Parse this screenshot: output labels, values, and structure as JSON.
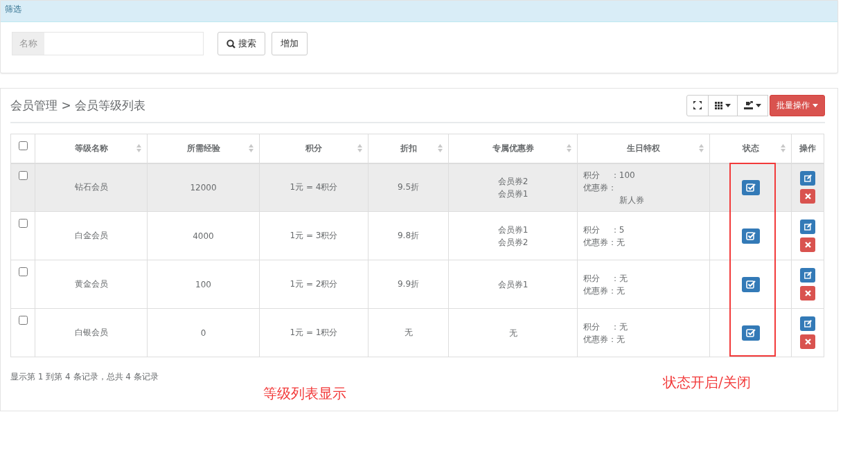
{
  "filter_panel": {
    "title": "筛选",
    "name_field": {
      "label": "名称"
    },
    "buttons": [
      {
        "kind": "search",
        "label": "搜索"
      },
      {
        "kind": "plain",
        "label": "增加"
      }
    ]
  },
  "list_panel": {
    "breadcrumb": "会员管理 > 会员等级列表",
    "toolbar": [
      {
        "kind": "fullscreen",
        "caret": false
      },
      {
        "kind": "columns",
        "caret": true
      },
      {
        "kind": "export",
        "caret": true
      },
      {
        "kind": "batch",
        "label": "批量操作",
        "caret": true
      }
    ],
    "table": {
      "select_all": {
        "checked": false
      },
      "columns": [
        {
          "label": "等级名称",
          "sortable": true
        },
        {
          "label": "所需经验",
          "sortable": true
        },
        {
          "label": "积分",
          "sortable": true
        },
        {
          "label": "折扣",
          "sortable": true
        },
        {
          "label": "专属优惠券",
          "sortable": true
        },
        {
          "label": "生日特权",
          "sortable": true
        },
        {
          "label": "状态",
          "sortable": true
        },
        {
          "label": "操作",
          "sortable": false
        }
      ],
      "rows": [
        {
          "checked": false,
          "highlighted": true,
          "name": "钻石会员",
          "experience": "12000",
          "points": "1元 = 4积分",
          "discount": "9.5折",
          "coupons": [
            "会员券2",
            "会员券1"
          ],
          "birthday": [
            {
              "text": "积分　 ：100",
              "indent": false
            },
            {
              "text": "优惠券：",
              "indent": false
            },
            {
              "text": "新人券",
              "indent": true
            }
          ],
          "enabled": true
        },
        {
          "checked": false,
          "highlighted": false,
          "name": "白金会员",
          "experience": "4000",
          "points": "1元 = 3积分",
          "discount": "9.8折",
          "coupons": [
            "会员券1",
            "会员券2"
          ],
          "birthday": [
            {
              "text": "积分　 ：5",
              "indent": false
            },
            {
              "text": "优惠券：无",
              "indent": false
            }
          ],
          "enabled": true
        },
        {
          "checked": false,
          "highlighted": false,
          "name": "黄金会员",
          "experience": "100",
          "points": "1元 = 2积分",
          "discount": "9.9折",
          "coupons": [
            "会员券1"
          ],
          "birthday": [
            {
              "text": "积分　 ：无",
              "indent": false
            },
            {
              "text": "优惠券：无",
              "indent": false
            }
          ],
          "enabled": true
        },
        {
          "checked": false,
          "highlighted": false,
          "name": "白银会员",
          "experience": "0",
          "points": "1元 = 1积分",
          "discount": "无",
          "coupons": [
            "无"
          ],
          "birthday": [
            {
              "text": "积分　 ：无",
              "indent": false
            },
            {
              "text": "优惠券：无",
              "indent": false
            }
          ],
          "enabled": true
        }
      ]
    },
    "pagination_info": "显示第 1 到第 4 条记录，总共 4 条记录"
  },
  "annotations": [
    {
      "kind": "text",
      "text": "等级列表显示"
    },
    {
      "kind": "text",
      "text": "状态开启/关闭"
    },
    {
      "kind": "box"
    }
  ]
}
